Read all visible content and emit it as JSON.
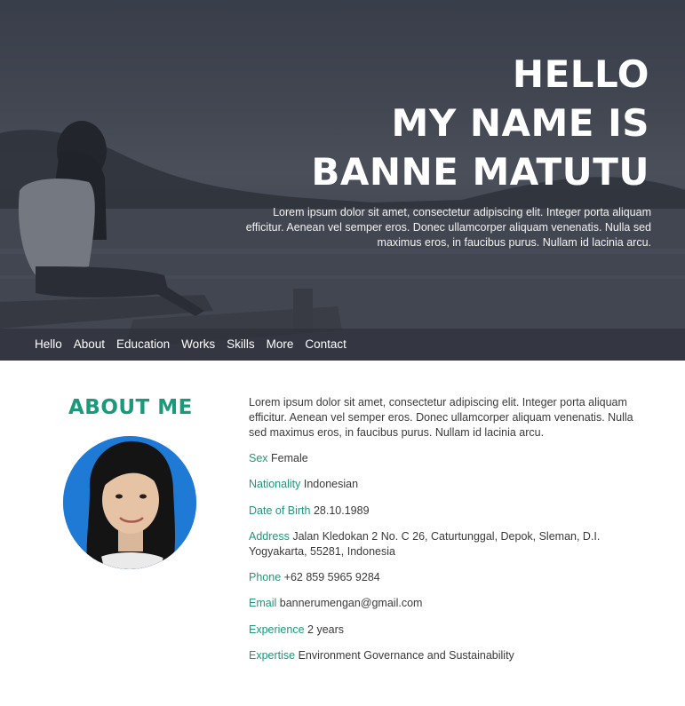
{
  "hero": {
    "title_lines": [
      "HELLO",
      "MY NAME IS",
      "BANNE MATUTU"
    ],
    "description": "Lorem ipsum dolor sit amet, consectetur adipiscing elit. Integer porta aliquam efficitur. Aenean vel semper eros. Donec ullamcorper aliquam venenatis. Nulla sed maximus eros, in faucibus purus. Nullam id lacinia arcu."
  },
  "nav": {
    "items": [
      "Hello",
      "About",
      "Education",
      "Works",
      "Skills",
      "More",
      "Contact"
    ]
  },
  "about": {
    "heading": "ABOUT ME",
    "intro": "Lorem ipsum dolor sit amet, consectetur adipiscing elit. Integer porta aliquam efficitur. Aenean vel semper eros. Donec ullamcorper aliquam venenatis. Nulla sed maximus eros, in faucibus purus. Nullam id lacinia arcu.",
    "details": [
      {
        "label": "Sex",
        "value": "Female"
      },
      {
        "label": "Nationality",
        "value": "Indonesian"
      },
      {
        "label": "Date of Birth",
        "value": "28.10.1989"
      },
      {
        "label": "Address",
        "value": "Jalan Kledokan 2 No. C 26, Caturtunggal, Depok, Sleman, D.I. Yogyakarta, 55281, Indonesia"
      },
      {
        "label": "Phone",
        "value": "+62 859 5965 9284"
      },
      {
        "label": "Email",
        "value": "bannerumengan@gmail.com"
      },
      {
        "label": "Experience",
        "value": "2 years"
      },
      {
        "label": "Expertise",
        "value": "Environment Governance and Sustainability"
      }
    ]
  },
  "colors": {
    "accent": "#1a9a7a",
    "hero_overlay": "#3d4350",
    "avatar_background": "#1f7ad6"
  }
}
